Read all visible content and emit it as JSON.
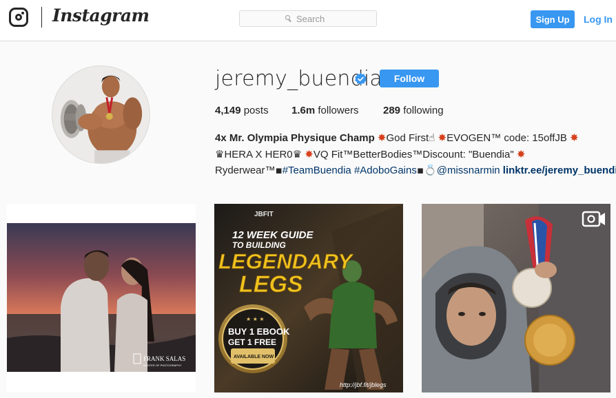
{
  "nav": {
    "wordmark": "Instagram",
    "search_placeholder": "Search",
    "signup_label": "Sign Up",
    "login_label": "Log In"
  },
  "profile": {
    "username": "jeremy_buendia",
    "verified": true,
    "follow_label": "Follow",
    "stats": [
      {
        "value": "4,149",
        "label": "posts"
      },
      {
        "value": "1.6m",
        "label": "followers"
      },
      {
        "value": "289",
        "label": "following"
      }
    ],
    "bio": {
      "name": "4x Mr. Olympia Physique Champ",
      "line1_a": "God First",
      "line1_b": "EVOGEN™ code: 15offJB",
      "line2_a": "HERA X HER0",
      "line2_b": "VQ Fit™BetterBodies™Discount: \"Buendia\"",
      "line3_a": "Ryderwear™",
      "hashtag1": "#TeamBuendia",
      "hashtag2": "#AdoboGains",
      "mention": "@missnarmin",
      "link": "linktr.ee/jeremy_buendia"
    }
  },
  "posts": [
    {
      "watermark": "FRANK SALAS",
      "watermark_sub": "MASTER OF PHOTOGRAPHY"
    },
    {
      "brand": "JBFIT",
      "line1": "12 WEEK GUIDE",
      "line2": "TO BUILDING",
      "title1": "LEGENDARY",
      "title2": "LEGS",
      "badge1": "BUY 1 EBOOK",
      "badge2": "GET 1 FREE",
      "badge3": "AVAILABLE NOW",
      "url": "http://jbf.fit/jblegs"
    },
    {
      "type": "video"
    }
  ],
  "colors": {
    "accent": "#3897f0",
    "link": "#003569",
    "border": "#dbdbdb",
    "emoji_burst": "#d6401c"
  }
}
